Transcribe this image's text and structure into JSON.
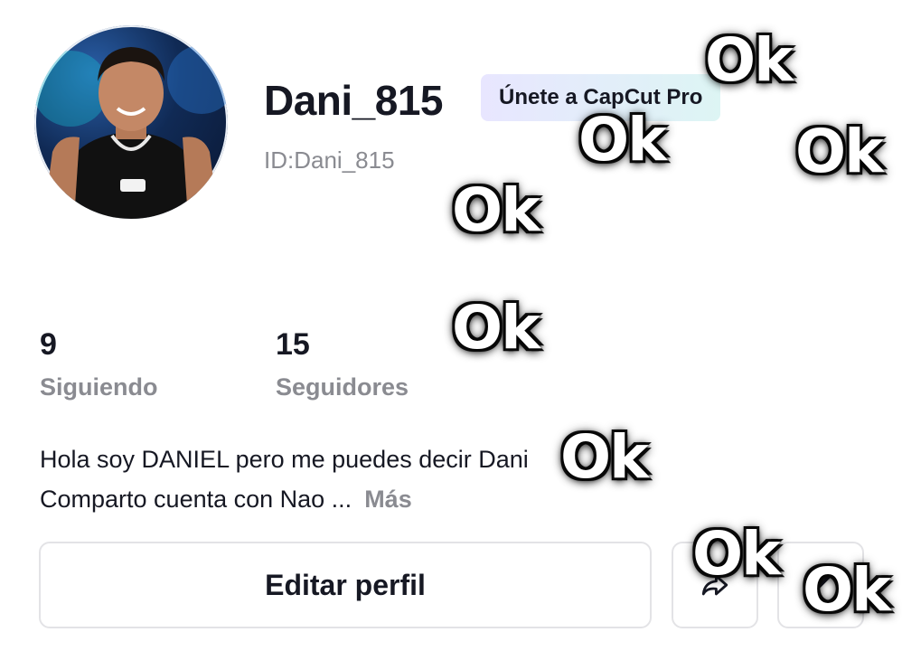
{
  "profile": {
    "username": "Dani_815",
    "pro_badge": "Únete a CapCut Pro",
    "id_label": "ID:Dani_815"
  },
  "stats": {
    "following": {
      "value": "9",
      "label": "Siguiendo"
    },
    "followers": {
      "value": "15",
      "label": "Seguidores"
    }
  },
  "bio": {
    "line1": "Hola soy DANIEL pero me puedes decir Dani",
    "line2": "Comparto cuenta  con Nao ...",
    "more": "Más"
  },
  "actions": {
    "edit_profile": "Editar perfil",
    "share_icon": "share-icon",
    "more_icon": "pencil-icon"
  },
  "stickers": {
    "ok": "Ok"
  },
  "colors": {
    "text": "#161823",
    "muted": "#8a8b91",
    "border": "#e3e3e6"
  }
}
